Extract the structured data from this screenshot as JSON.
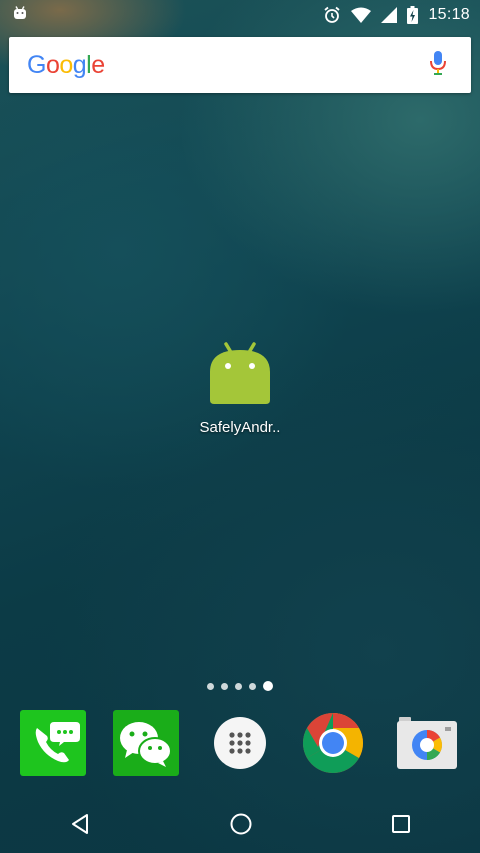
{
  "status_bar": {
    "time": "15:18",
    "icons": [
      "android-notification-icon",
      "alarm-icon",
      "wifi-icon",
      "signal-icon",
      "battery-charging-icon"
    ]
  },
  "search": {
    "logo_text": "Google",
    "logo_colors": [
      "#4285F4",
      "#EA4335",
      "#FBBC05",
      "#4285F4",
      "#34A853",
      "#EA4335"
    ]
  },
  "home": {
    "apps": [
      {
        "label": "SafelyAndr..",
        "icon": "android-app-icon"
      }
    ]
  },
  "page_indicator": {
    "count": 5,
    "active_index": 4
  },
  "dock": {
    "apps": [
      "phone-icon",
      "wechat-icon",
      "app-drawer-icon",
      "chrome-icon",
      "camera-icon"
    ]
  },
  "nav": {
    "buttons": [
      "back",
      "home",
      "recents"
    ]
  },
  "colors": {
    "android_green": "#A4C639",
    "wechat_green": "#1AAD19",
    "phone_green": "#1EC51E"
  }
}
